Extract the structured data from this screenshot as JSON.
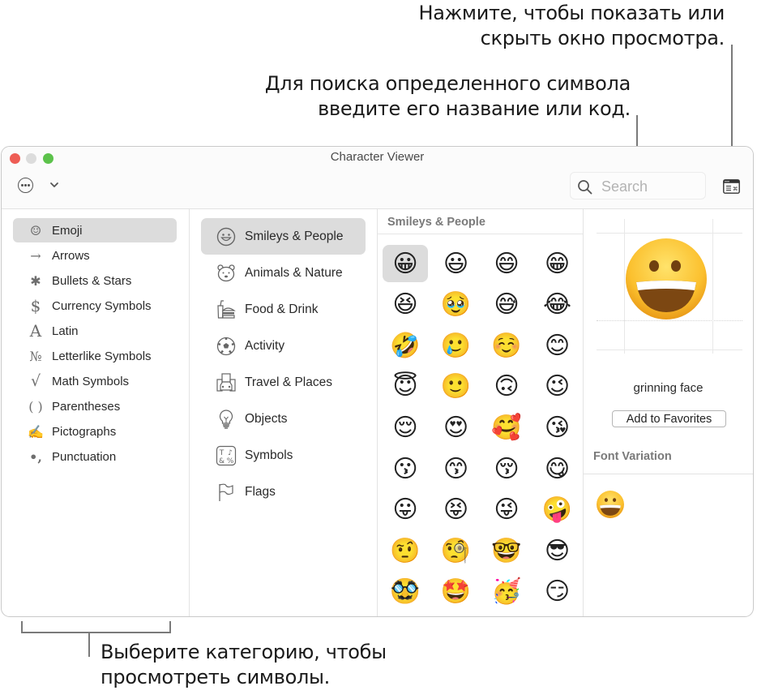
{
  "callouts": {
    "viewer_toggle_line1": "Нажмите, чтобы показать или",
    "viewer_toggle_line2": "скрыть окно просмотра.",
    "search_line1": "Для поиска определенного символа",
    "search_line2": "введите его название или код.",
    "categories_line1": "Выберите категорию, чтобы",
    "categories_line2": "просмотреть символы."
  },
  "window": {
    "title": "Character Viewer",
    "search_placeholder": "Search",
    "search_value": "",
    "more_button": "ellipsis-circle-icon",
    "chevron": "chevron-down-icon",
    "viewer_toggle": "preview-panel-icon"
  },
  "categories": {
    "selected": "Emoji",
    "items": [
      {
        "label": "Emoji",
        "icon": "☺"
      },
      {
        "label": "Arrows",
        "icon": "→"
      },
      {
        "label": "Bullets & Stars",
        "icon": "✱"
      },
      {
        "label": "Currency Symbols",
        "icon": "$"
      },
      {
        "label": "Latin",
        "icon": "A"
      },
      {
        "label": "Letterlike Symbols",
        "icon": "№"
      },
      {
        "label": "Math Symbols",
        "icon": "√"
      },
      {
        "label": "Parentheses",
        "icon": "( )"
      },
      {
        "label": "Pictographs",
        "icon": "✍"
      },
      {
        "label": "Punctuation",
        "icon": "•,"
      }
    ]
  },
  "subcategories": {
    "selected": "Smileys & People",
    "items": [
      {
        "label": "Smileys & People",
        "icon": "smiley-icon"
      },
      {
        "label": "Animals & Nature",
        "icon": "bear-icon"
      },
      {
        "label": "Food & Drink",
        "icon": "burger-icon"
      },
      {
        "label": "Activity",
        "icon": "soccer-ball-icon"
      },
      {
        "label": "Travel & Places",
        "icon": "car-buildings-icon"
      },
      {
        "label": "Objects",
        "icon": "lightbulb-icon"
      },
      {
        "label": "Symbols",
        "icon": "symbols-icon"
      },
      {
        "label": "Flags",
        "icon": "flag-icon"
      }
    ]
  },
  "emoji_grid": {
    "header": "Smileys & People",
    "selected_index": 0,
    "items": [
      "😀",
      "😃",
      "😄",
      "😁",
      "😆",
      "🥹",
      "😅",
      "😂",
      "🤣",
      "🥲",
      "☺️",
      "😊",
      "😇",
      "🙂",
      "🙃",
      "😉",
      "😌",
      "😍",
      "🥰",
      "😘",
      "😗",
      "😙",
      "😚",
      "😋",
      "😛",
      "😝",
      "😜",
      "🤪",
      "🤨",
      "🧐",
      "🤓",
      "😎",
      "🥸",
      "🤩",
      "🥳",
      "😏"
    ]
  },
  "info_panel": {
    "character": "😀",
    "character_name": "grinning face",
    "add_favorites_label": "Add to Favorites",
    "font_variation_header": "Font Variation",
    "font_variations": [
      "😀"
    ]
  }
}
